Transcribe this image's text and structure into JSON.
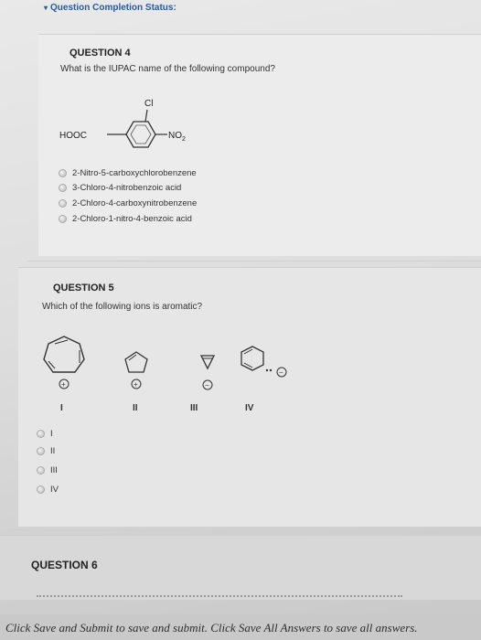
{
  "status": {
    "label": "Question Completion Status:"
  },
  "q4": {
    "title": "QUESTION 4",
    "prompt": "What is the IUPAC name of the following compound?",
    "structure": {
      "cl": "Cl",
      "left": "HOOC",
      "right": "NO",
      "sub": "2"
    },
    "options": [
      "2-Nitro-5-carboxychlorobenzene",
      "3-Chloro-4-nitrobenzoic acid",
      "2-Chloro-4-carboxynitrobenzene",
      "2-Chloro-1-nitro-4-benzoic acid"
    ]
  },
  "q5": {
    "title": "QUESTION 5",
    "prompt": "Which of the following ions is aromatic?",
    "structure_labels": [
      "I",
      "II",
      "III",
      "IV"
    ],
    "options": [
      "I",
      "II",
      "III",
      "IV"
    ]
  },
  "q6": {
    "title": "QUESTION 6"
  },
  "footer": {
    "text": "Click Save and Submit to save and submit. Click Save All Answers to save all answers."
  }
}
